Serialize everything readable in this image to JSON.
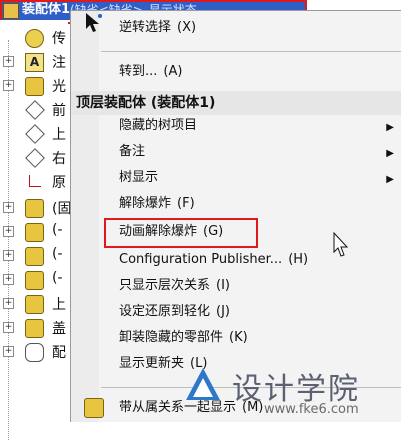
{
  "tree": {
    "title": "装配体1",
    "title_extra": "(缺省<缺省>_显示状态",
    "rows": [
      {
        "label": "传",
        "icon": "sensor-icon"
      },
      {
        "label": "注",
        "icon": "annotation-icon"
      },
      {
        "label": "光",
        "icon": "lights-icon"
      },
      {
        "label": "前",
        "icon": "plane-icon"
      },
      {
        "label": "上",
        "icon": "plane-icon"
      },
      {
        "label": "右",
        "icon": "plane-icon"
      },
      {
        "label": "原",
        "icon": "origin-icon"
      },
      {
        "label": "(固",
        "icon": "part-icon"
      },
      {
        "label": "(-",
        "icon": "part-icon"
      },
      {
        "label": "(-",
        "icon": "part-icon"
      },
      {
        "label": "(-",
        "icon": "part-icon"
      },
      {
        "label": "上",
        "icon": "part-icon"
      },
      {
        "label": "盖",
        "icon": "part-icon"
      },
      {
        "label": "配",
        "icon": "mates-icon"
      }
    ]
  },
  "menu": {
    "top_item": {
      "label": "逆转选择",
      "key": "(X)"
    },
    "goto": {
      "label": "转到...",
      "key": "(A)"
    },
    "header": "顶层装配体 (装配体1)",
    "items": [
      {
        "label": "隐藏的树项目",
        "key": "",
        "submenu": true
      },
      {
        "label": "备注",
        "key": "",
        "submenu": true
      },
      {
        "label": "树显示",
        "key": "",
        "submenu": true
      },
      {
        "label": "解除爆炸",
        "key": "(F)",
        "submenu": false
      },
      {
        "label": "动画解除爆炸",
        "key": "(G)",
        "submenu": false
      },
      {
        "label": "Configuration Publisher...",
        "key": "(H)",
        "submenu": false
      },
      {
        "label": "只显示层次关系",
        "key": "(I)",
        "submenu": false
      },
      {
        "label": "设定还原到轻化",
        "key": "(J)",
        "submenu": false
      },
      {
        "label": "卸装隐藏的零部件",
        "key": "(K)",
        "submenu": false
      },
      {
        "label": "显示更新夹",
        "key": "(L)",
        "submenu": false
      }
    ],
    "bottom_item": {
      "label": "带从属关系一起显示",
      "key": "(M)"
    }
  },
  "watermark": {
    "text": "设计学院",
    "url": "www.fke6.com"
  },
  "colors": {
    "title_bar": "#2f5fc6",
    "highlight_box": "#e01a1a",
    "menu_bg": "#f3f3f3"
  }
}
